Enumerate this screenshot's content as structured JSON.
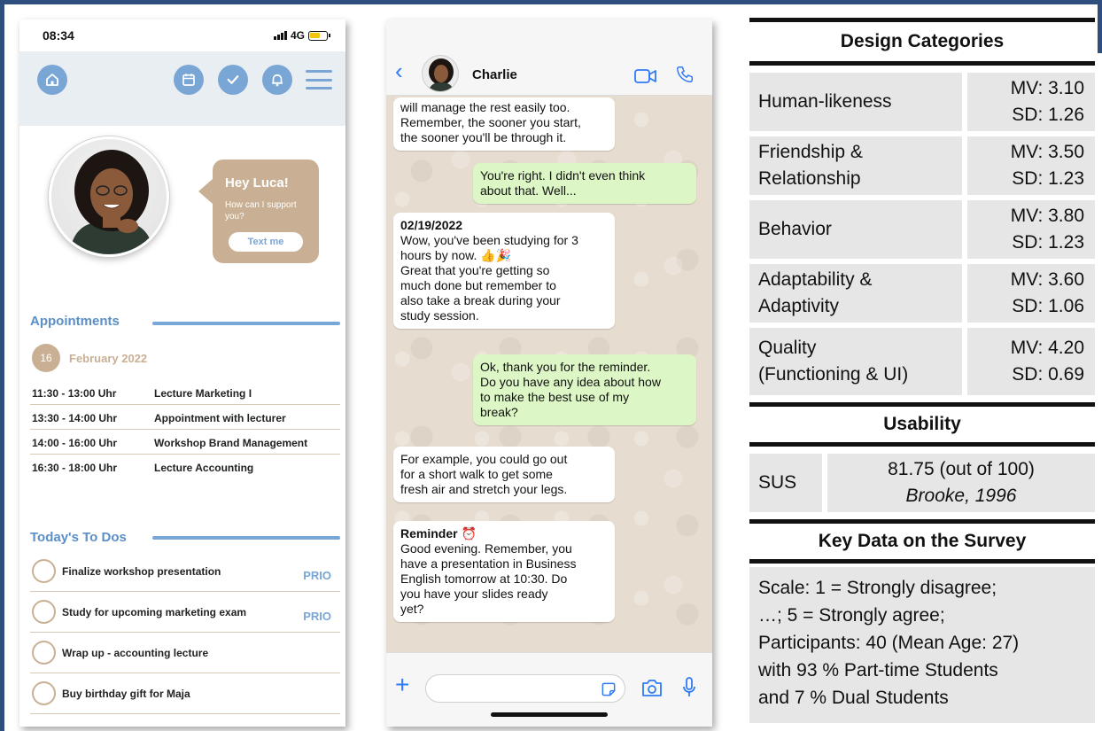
{
  "colors": {
    "frame": "#2e4f7e",
    "accent_blue": "#7aa6d6",
    "accent_tan": "#c9b094",
    "chat_bg": "#e6dccf",
    "incoming_bubble": "#ffffff",
    "outgoing_bubble": "#dcf6c5",
    "table_cell": "#e6e6e6"
  },
  "app": {
    "status": {
      "time": "08:34",
      "network": "4G"
    },
    "header_icons": [
      "home-icon",
      "calendar-icon",
      "check-icon",
      "bell-icon",
      "menu-icon"
    ],
    "greeting": {
      "title": "Hey Luca!",
      "subtitle": "How can I support you?",
      "button": "Text me"
    },
    "appointments": {
      "title": "Appointments",
      "day": "16",
      "month": "February 2022",
      "rows": [
        {
          "time": "11:30 - 13:00 Uhr",
          "title": "Lecture Marketing I"
        },
        {
          "time": "13:30 - 14:00 Uhr",
          "title": "Appointment with lecturer"
        },
        {
          "time": "14:00 - 16:00 Uhr",
          "title": "Workshop Brand Management"
        },
        {
          "time": "16:30 - 18:00 Uhr",
          "title": "Lecture Accounting"
        }
      ]
    },
    "todos": {
      "title": "Today's To Dos",
      "items": [
        {
          "text": "Finalize workshop presentation",
          "tag": "PRIO"
        },
        {
          "text": "Study for upcoming marketing exam",
          "tag": "PRIO"
        },
        {
          "text": "Wrap up -  accounting lecture",
          "tag": ""
        },
        {
          "text": "Buy birthday gift for Maja",
          "tag": ""
        }
      ]
    }
  },
  "chat": {
    "contact_name": "Charlie",
    "messages": [
      {
        "dir": "in",
        "lines": [
          "will manage the rest easily too.",
          "Remember, the sooner you start,",
          "the sooner you'll be through it."
        ]
      },
      {
        "dir": "out",
        "lines": [
          "You're right. I didn't even think",
          "about that. Well..."
        ]
      },
      {
        "dir": "in",
        "header": "02/19/2022",
        "lines": [
          "Wow, you've been studying for 3",
          "hours by now. 👍🎉",
          "Great that you're getting so",
          "much done but remember to",
          "also take a break during your",
          "study session."
        ]
      },
      {
        "dir": "out",
        "lines": [
          "Ok, thank you for the reminder.",
          "Do you have any idea about how",
          "to make the best use of my",
          "break?"
        ]
      },
      {
        "dir": "in",
        "lines": [
          "For example, you could go out",
          "for a short walk to get some",
          "fresh air and stretch your legs."
        ]
      },
      {
        "dir": "in",
        "header": "Reminder ⏰",
        "lines": [
          "Good evening. Remember, you",
          "have a presentation in Business",
          "English tomorrow at 10:30. Do",
          "you have your slides ready",
          "yet?"
        ]
      }
    ]
  },
  "results": {
    "design_header": "Design Categories",
    "categories": [
      {
        "name_lines": [
          "Human-likeness"
        ],
        "mv": "MV: 3.10",
        "sd": "SD: 1.26"
      },
      {
        "name_lines": [
          "Friendship &",
          "Relationship"
        ],
        "mv": "MV: 3.50",
        "sd": "SD: 1.23"
      },
      {
        "name_lines": [
          "Behavior"
        ],
        "mv": "MV: 3.80",
        "sd": "SD: 1.23"
      },
      {
        "name_lines": [
          "Adaptability &",
          "Adaptivity"
        ],
        "mv": "MV: 3.60",
        "sd": "SD: 1.06"
      },
      {
        "name_lines": [
          "Quality",
          "(Functioning & UI)"
        ],
        "mv": "MV: 4.20",
        "sd": "SD: 0.69"
      }
    ],
    "usability_header": "Usability",
    "sus_label": "SUS",
    "sus_value": "81.75 (out of 100)",
    "sus_ref": "Brooke, 1996",
    "survey_header": "Key Data on the Survey",
    "survey_lines": [
      "Scale: 1 = Strongly disagree;",
      "…; 5 = Strongly agree;",
      "Participants: 40 (Mean Age: 27)",
      "with 93 % Part-time Students",
      "and 7 % Dual Students"
    ]
  }
}
